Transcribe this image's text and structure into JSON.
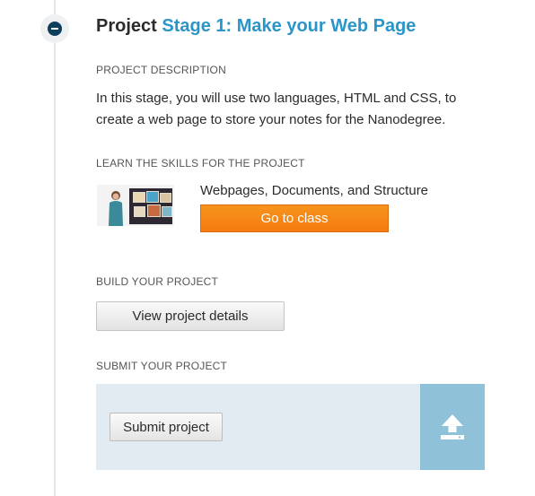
{
  "project": {
    "prefix": "Project",
    "stage": "Stage 1: Make your Web Page",
    "description_label": "PROJECT DESCRIPTION",
    "description": "In this stage, you will use two languages, HTML and CSS, to create a web page to store your notes for the Nanodegree."
  },
  "learn": {
    "label": "LEARN THE SKILLS FOR THE PROJECT",
    "lesson_title": "Webpages, Documents, and Structure",
    "button_label": "Go to class"
  },
  "build": {
    "label": "BUILD YOUR PROJECT",
    "button_label": "View project details"
  },
  "submit": {
    "label": "SUBMIT YOUR PROJECT",
    "button_label": "Submit project",
    "upload_icon": "upload-icon"
  },
  "colors": {
    "accent_blue": "#2a95c8",
    "class_button": "#f7941d",
    "submit_panel": "#e1ebf1",
    "upload_area": "#8fc2d9",
    "badge_dark": "#0b3f5c"
  }
}
